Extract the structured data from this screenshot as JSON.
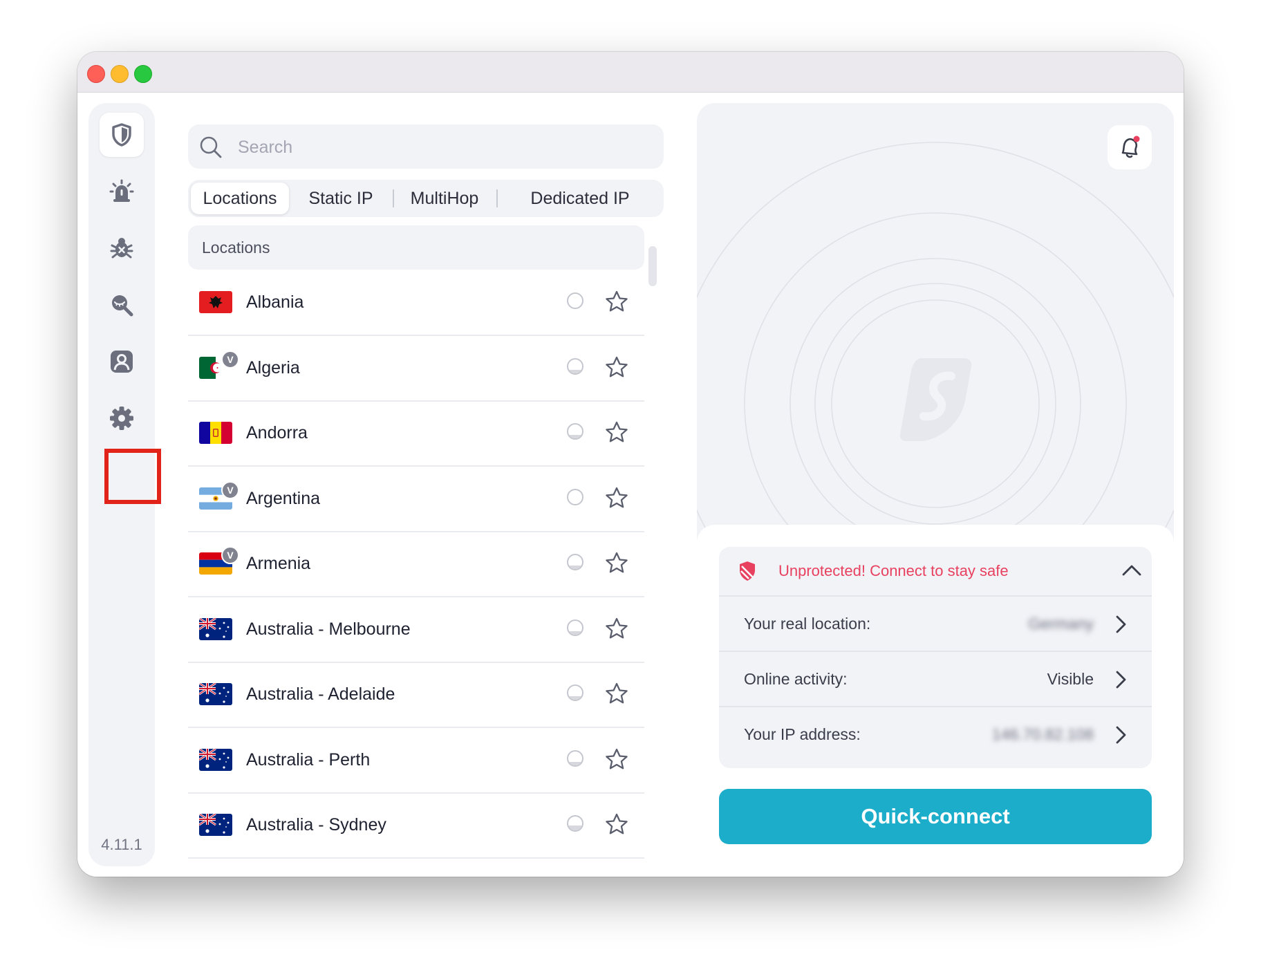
{
  "sidebar": {
    "items": [
      {
        "name": "shield-icon",
        "active": true
      },
      {
        "name": "alert-icon",
        "active": false
      },
      {
        "name": "antivirus-icon",
        "active": false
      },
      {
        "name": "search-engine-icon",
        "active": false
      },
      {
        "name": "account-icon",
        "active": false
      },
      {
        "name": "gear-icon",
        "active": false
      }
    ],
    "version": "4.11.1"
  },
  "search": {
    "placeholder": "Search"
  },
  "tabs": [
    {
      "label": "Locations",
      "active": true
    },
    {
      "label": "Static IP",
      "active": false
    },
    {
      "label": "MultiHop",
      "active": false
    },
    {
      "label": "Dedicated IP",
      "active": false
    }
  ],
  "list": {
    "header": "Locations",
    "items": [
      {
        "name": "Albania",
        "flag": "albania",
        "virtual": false,
        "load": 0.0
      },
      {
        "name": "Algeria",
        "flag": "algeria",
        "virtual": true,
        "load": 0.25
      },
      {
        "name": "Andorra",
        "flag": "andorra",
        "virtual": false,
        "load": 0.25
      },
      {
        "name": "Argentina",
        "flag": "argentina",
        "virtual": true,
        "load": 0.0
      },
      {
        "name": "Armenia",
        "flag": "armenia",
        "virtual": true,
        "load": 0.25
      },
      {
        "name": "Australia - Melbourne",
        "flag": "australia",
        "virtual": false,
        "load": 0.25
      },
      {
        "name": "Australia - Adelaide",
        "flag": "australia",
        "virtual": false,
        "load": 0.25
      },
      {
        "name": "Australia - Perth",
        "flag": "australia",
        "virtual": false,
        "load": 0.25
      },
      {
        "name": "Australia - Sydney",
        "flag": "australia",
        "virtual": false,
        "load": 0.35
      }
    ]
  },
  "status": {
    "title": "Unprotected! Connect to stay safe",
    "rows": [
      {
        "label": "Your real location:",
        "value": "Germany",
        "blurred": true
      },
      {
        "label": "Online activity:",
        "value": "Visible",
        "blurred": false
      },
      {
        "label": "Your IP address:",
        "value": "146.70.82.108",
        "blurred": true
      }
    ]
  },
  "quick_connect_label": "Quick-connect",
  "colors": {
    "accent": "#1badc9",
    "danger": "#e8405f",
    "window_close": "#fe5f57",
    "window_minimize": "#febc2e",
    "window_zoom": "#28c840"
  }
}
